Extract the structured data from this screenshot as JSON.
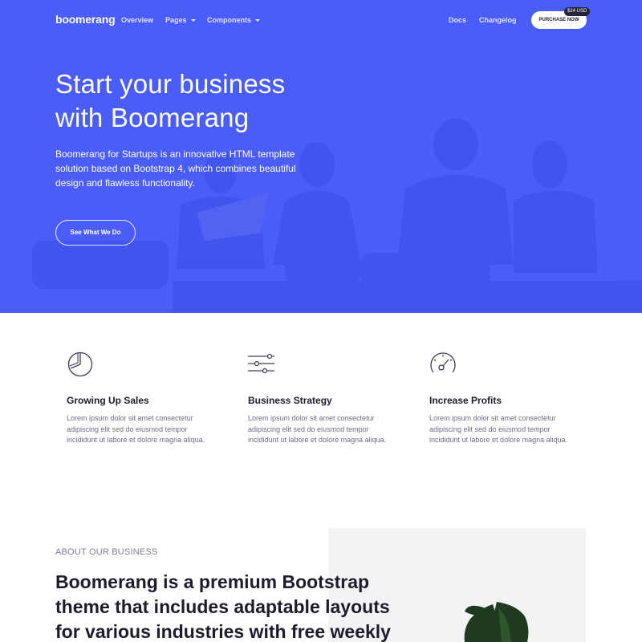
{
  "colors": {
    "hero_bg": "#4a5df8",
    "text_dark": "#1c1c2b",
    "text_muted": "#6b6e80",
    "badge_bg": "#23233a"
  },
  "nav": {
    "brand": "boomerang",
    "links": [
      "Overview",
      "Pages",
      "Components",
      "Docs",
      "Changelog"
    ],
    "purchase_label": "PURCHASE NOW",
    "price_badge": "$24 USD"
  },
  "hero": {
    "title_line1": "Start your business",
    "title_line2": "with Boomerang",
    "subtitle_line1": "Boomerang for Startups is an innovative HTML template",
    "subtitle_line2": "solution based on Bootstrap 4, which combines beautiful",
    "subtitle_line3": "design and flawless functionality.",
    "cta_label": "See What We Do"
  },
  "features": [
    {
      "icon": "pie-chart-icon",
      "title": "Growing Up Sales",
      "text_line1": "Lorem ipsum dolor sit amet consectetur",
      "text_line2": "adipiscing elit sed do eiusmod tempor",
      "text_line3": "incididunt ut labore et dolore magna aliqua."
    },
    {
      "icon": "sliders-icon",
      "title": "Business Strategy",
      "text_line1": "Lorem ipsum dolor sit amet consectetur",
      "text_line2": "adipiscing elit sed do eiusmod tempor",
      "text_line3": "incididunt ut labore et dolore magna aliqua."
    },
    {
      "icon": "speedometer-icon",
      "title": "Increase Profits",
      "text_line1": "Lorem ipsum dolor sit amet consectetur",
      "text_line2": "adipiscing elit sed do eiusmod tempor",
      "text_line3": "incididunt ut labore et dolore magna aliqua."
    }
  ],
  "about": {
    "eyebrow": "ABOUT OUR BUSINESS",
    "title_line1": "Boomerang is a premium Bootstrap",
    "title_line2": "theme that includes adaptable layouts",
    "title_line3": "for various industries with free weekly"
  }
}
